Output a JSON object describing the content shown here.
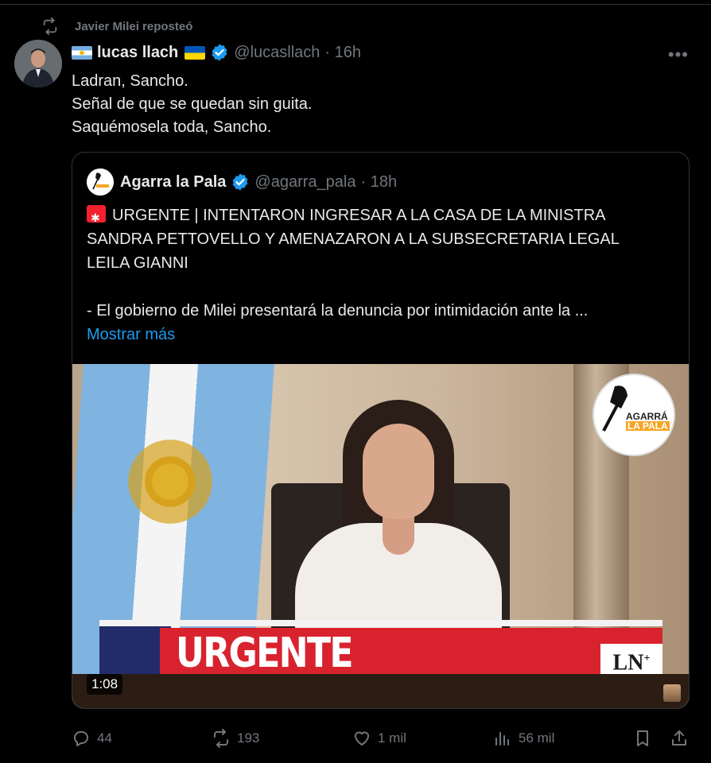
{
  "repost": {
    "text": "Javier Milei reposteó"
  },
  "tweet": {
    "author_name": "lucas llach",
    "handle": "@lucasllach",
    "time": "· 16h",
    "lines": [
      "Ladran, Sancho.",
      "Señal de que se quedan sin guita.",
      "Saquémosela toda, Sancho."
    ]
  },
  "quote": {
    "author_name": "Agarra la Pala",
    "handle": "@agarra_pala",
    "time": "· 18h",
    "lines": [
      "URGENTE | INTENTARON INGRESAR A LA CASA DE LA MINISTRA",
      "SANDRA PETTOVELLO Y AMENAZARON A LA SUBSECRETARIA LEGAL",
      "LEILA GIANNI",
      "- El gobierno de Milei presentará la denuncia por intimidación ante la ..."
    ],
    "show_more": "Mostrar más",
    "video": {
      "banner": "URGENTE",
      "channel_logo": "LN",
      "watermark_top": "AGARRÁ",
      "watermark_bottom": "LA PALA",
      "duration": "1:08"
    }
  },
  "actions": {
    "replies": "44",
    "reposts": "193",
    "likes": "1 mil",
    "views": "56 mil"
  },
  "colors": {
    "accent": "#1d9bf0",
    "muted": "#71767b",
    "verified": "#1d9bf0"
  }
}
